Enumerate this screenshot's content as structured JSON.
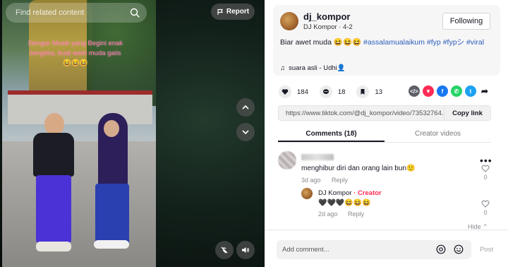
{
  "video": {
    "search_placeholder": "Find related content",
    "report_label": "Report",
    "caption_overlay": "Dengar Musik yang Begini enak bergeka, buat awet muda gaiis 😆😆😆",
    "icons": {
      "search": "search-icon",
      "report": "flag-icon",
      "up": "chevron-up-icon",
      "down": "chevron-down-icon",
      "mute": "no-tiktok-icon",
      "volume": "volume-icon"
    }
  },
  "author": {
    "username": "dj_kompor",
    "subline": "DJ Kompor · 4-2",
    "follow_label": "Following",
    "description_text": "Biar awet muda 😆😆😆",
    "hashtags": [
      "#assalamualaikum",
      "#fyp",
      "#fypシ",
      "#viral"
    ],
    "music": "suara asli - Udhi👤"
  },
  "actions": {
    "likes": "184",
    "comments": "18",
    "saves": "13",
    "share_colors": {
      "embed": "#5f5f68",
      "send": "#fe2c55",
      "facebook": "#1877f2",
      "whatsapp": "#25d366",
      "twitter": "#1da1f2"
    }
  },
  "link": {
    "url": "https://www.tiktok.com/@dj_kompor/video/73532764...",
    "copy_label": "Copy link"
  },
  "tabs": [
    {
      "label": "Comments (18)",
      "active": true
    },
    {
      "label": "Creator videos",
      "active": false
    }
  ],
  "comments": {
    "first": {
      "text": "menghibur diri dan orang lain bun🙂",
      "date": "3d ago",
      "reply": "Reply",
      "likes": "0"
    },
    "reply": {
      "author": "DJ Kompor",
      "badge": "· Creator",
      "text": "🖤🖤🖤😆😆😆",
      "date": "2d ago",
      "reply": "Reply",
      "likes": "0"
    },
    "hide_label": "Hide"
  },
  "footer": {
    "placeholder": "Add comment...",
    "post_label": "Post"
  },
  "colors": {
    "accent_link": "#2b5db9",
    "creator_badge": "#fe2c55"
  }
}
